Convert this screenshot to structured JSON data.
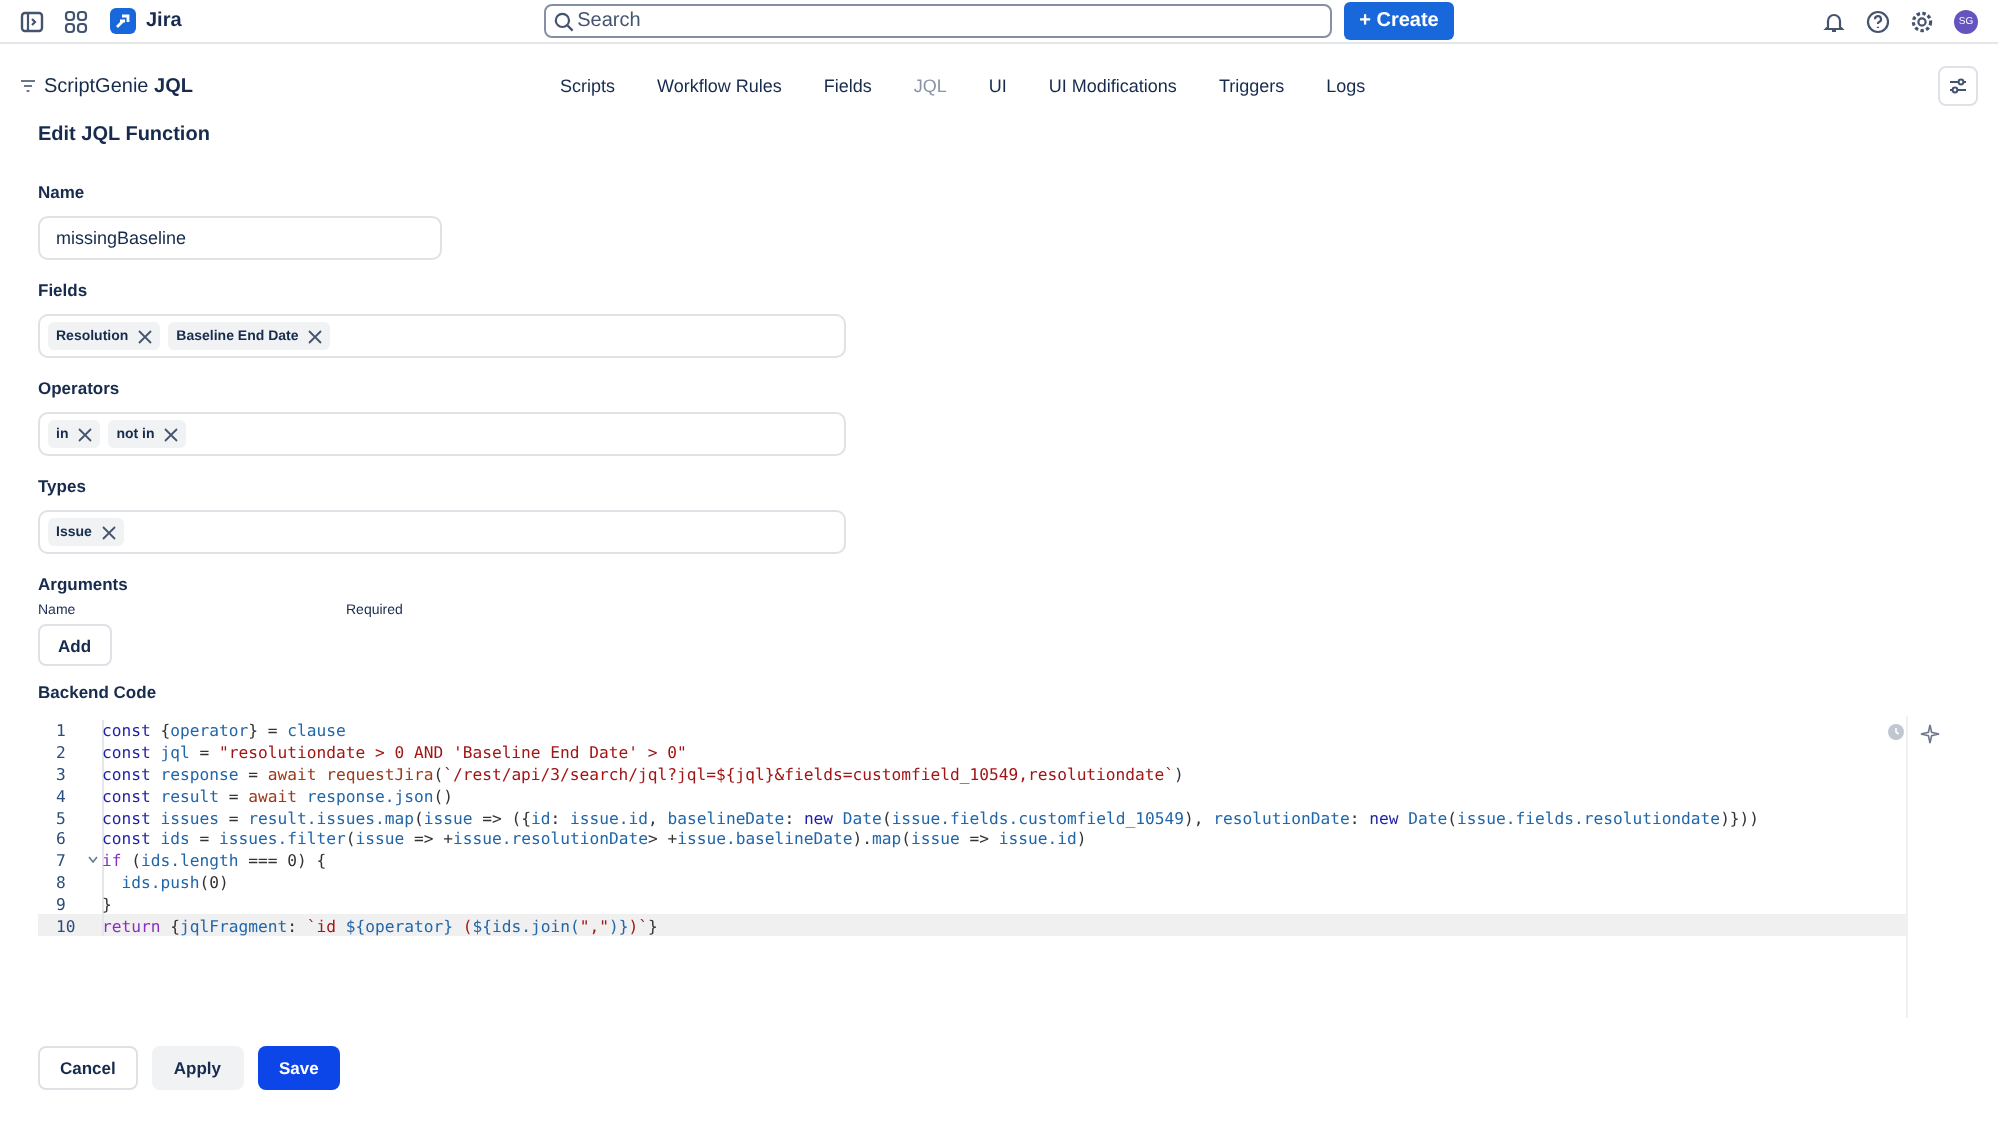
{
  "topbar": {
    "app_name": "Jira",
    "search": {
      "placeholder": "Search"
    },
    "create_button": "+ Create",
    "avatar": "SG"
  },
  "app_header": {
    "title": "ScriptGenie **JQL**",
    "tabs": [
      {
        "label": "Scripts",
        "selected": false
      },
      {
        "label": "Workflow Rules",
        "selected": false
      },
      {
        "label": "Fields",
        "selected": false
      },
      {
        "label": "JQL",
        "selected": true
      },
      {
        "label": "UI",
        "selected": false
      },
      {
        "label": "UI Modifications",
        "selected": false
      },
      {
        "label": "Triggers",
        "selected": false
      },
      {
        "label": "Logs",
        "selected": false
      }
    ]
  },
  "page_title": "Edit JQL Function",
  "form": {
    "name": {
      "label": "Name",
      "value": "missingBaseline"
    },
    "multi_selects": [
      {
        "label": "Fields",
        "tags": [
          "Resolution",
          "Baseline End Date"
        ]
      },
      {
        "label": "Operators",
        "tags": [
          "in",
          "not in"
        ]
      },
      {
        "label": "Types",
        "tags": [
          "Issue"
        ]
      }
    ],
    "arguments": {
      "label": "Arguments",
      "columns": [
        "Name",
        "Required"
      ],
      "add_button": "Add"
    },
    "backend_code": {
      "label": "Backend Code",
      "lines": [
        {
          "number": "1",
          "foldable": false,
          "active": false,
          "tokens": [
            {
              "kind": "keyword",
              "text": "const"
            },
            {
              "kind": "punct",
              "text": " {"
            },
            {
              "kind": "variable",
              "text": "operator"
            },
            {
              "kind": "punct",
              "text": "} = "
            },
            {
              "kind": "variable",
              "text": "clause"
            }
          ]
        },
        {
          "number": "2",
          "foldable": false,
          "active": false,
          "tokens": [
            {
              "kind": "keyword",
              "text": "const"
            },
            {
              "kind": "variable",
              "text": " jql"
            },
            {
              "kind": "punct",
              "text": " = "
            },
            {
              "kind": "string",
              "text": "\"resolutiondate > 0 AND 'Baseline End Date' > 0\""
            }
          ]
        },
        {
          "number": "3",
          "foldable": false,
          "active": false,
          "tokens": [
            {
              "kind": "keyword",
              "text": "const"
            },
            {
              "kind": "variable",
              "text": " response"
            },
            {
              "kind": "punct",
              "text": " = "
            },
            {
              "kind": "call",
              "text": "await requestJira"
            },
            {
              "kind": "punct",
              "text": "("
            },
            {
              "kind": "string",
              "text": "`/rest/api/3/search/jql?jql=${jql}&fields=customfield_10549,resolutiondate`"
            },
            {
              "kind": "punct",
              "text": ")"
            }
          ]
        },
        {
          "number": "4",
          "foldable": false,
          "active": false,
          "tokens": [
            {
              "kind": "keyword",
              "text": "const"
            },
            {
              "kind": "variable",
              "text": " result"
            },
            {
              "kind": "punct",
              "text": " = "
            },
            {
              "kind": "call",
              "text": "await"
            },
            {
              "kind": "variable",
              "text": " response.json"
            },
            {
              "kind": "punct",
              "text": "()"
            }
          ]
        },
        {
          "number": "5",
          "foldable": false,
          "active": false,
          "tokens": [
            {
              "kind": "keyword",
              "text": "const"
            },
            {
              "kind": "variable",
              "text": " issues"
            },
            {
              "kind": "punct",
              "text": " = "
            },
            {
              "kind": "variable",
              "text": "result.issues.map"
            },
            {
              "kind": "punct",
              "text": "("
            },
            {
              "kind": "variable",
              "text": "issue"
            },
            {
              "kind": "punct",
              "text": " => ({"
            },
            {
              "kind": "variable",
              "text": "id"
            },
            {
              "kind": "punct",
              "text": ": "
            },
            {
              "kind": "variable",
              "text": "issue.id"
            },
            {
              "kind": "punct",
              "text": ", "
            },
            {
              "kind": "variable",
              "text": "baselineDate"
            },
            {
              "kind": "punct",
              "text": ": "
            },
            {
              "kind": "keyword",
              "text": "new"
            },
            {
              "kind": "variable",
              "text": " Date"
            },
            {
              "kind": "punct",
              "text": "("
            },
            {
              "kind": "variable",
              "text": "issue.fields.customfield_10549"
            },
            {
              "kind": "punct",
              "text": "), "
            },
            {
              "kind": "variable",
              "text": "resolutionDate"
            },
            {
              "kind": "punct",
              "text": ": "
            },
            {
              "kind": "keyword",
              "text": "new"
            },
            {
              "kind": "variable",
              "text": " Date"
            },
            {
              "kind": "punct",
              "text": "("
            },
            {
              "kind": "variable",
              "text": "issue.fields.resolutiondate"
            },
            {
              "kind": "punct",
              "text": ")}))"
            }
          ]
        },
        {
          "number": "6",
          "foldable": false,
          "active": false,
          "tokens": [
            {
              "kind": "keyword",
              "text": "const"
            },
            {
              "kind": "variable",
              "text": " ids"
            },
            {
              "kind": "punct",
              "text": " = "
            },
            {
              "kind": "variable",
              "text": "issues.filter"
            },
            {
              "kind": "punct",
              "text": "("
            },
            {
              "kind": "variable",
              "text": "issue"
            },
            {
              "kind": "punct",
              "text": " => +"
            },
            {
              "kind": "variable",
              "text": "issue.resolutionDate"
            },
            {
              "kind": "punct",
              "text": "> +"
            },
            {
              "kind": "variable",
              "text": "issue.baselineDate"
            },
            {
              "kind": "punct",
              "text": ")."
            },
            {
              "kind": "variable",
              "text": "map"
            },
            {
              "kind": "punct",
              "text": "("
            },
            {
              "kind": "variable",
              "text": "issue"
            },
            {
              "kind": "punct",
              "text": " => "
            },
            {
              "kind": "variable",
              "text": "issue.id"
            },
            {
              "kind": "punct",
              "text": ")"
            }
          ]
        },
        {
          "number": "7",
          "foldable": true,
          "active": false,
          "tokens": [
            {
              "kind": "control",
              "text": "if"
            },
            {
              "kind": "punct",
              "text": " ("
            },
            {
              "kind": "variable",
              "text": "ids.length"
            },
            {
              "kind": "punct",
              "text": " === 0) {"
            }
          ]
        },
        {
          "number": "8",
          "foldable": false,
          "active": false,
          "tokens": [
            {
              "kind": "variable",
              "text": "  ids.push"
            },
            {
              "kind": "punct",
              "text": "(0)"
            }
          ]
        },
        {
          "number": "9",
          "foldable": false,
          "active": false,
          "tokens": [
            {
              "kind": "punct",
              "text": "}"
            }
          ]
        },
        {
          "number": "10",
          "foldable": false,
          "active": true,
          "tokens": [
            {
              "kind": "control",
              "text": "return"
            },
            {
              "kind": "punct",
              "text": " {"
            },
            {
              "kind": "variable",
              "text": "jqlFragment"
            },
            {
              "kind": "punct",
              "text": ": "
            },
            {
              "kind": "string",
              "text": "`id "
            },
            {
              "kind": "variable",
              "text": "${operator}"
            },
            {
              "kind": "string",
              "text": " ("
            },
            {
              "kind": "variable",
              "text": "${ids.join("
            },
            {
              "kind": "string",
              "text": "\",\""
            },
            {
              "kind": "variable",
              "text": ")}"
            },
            {
              "kind": "string",
              "text": ")`"
            },
            {
              "kind": "punct",
              "text": "}"
            }
          ]
        }
      ]
    }
  },
  "footer_buttons": [
    {
      "label": "Cancel",
      "kind": "outline"
    },
    {
      "label": "Apply",
      "kind": "subtle"
    },
    {
      "label": "Save",
      "kind": "primary"
    }
  ]
}
